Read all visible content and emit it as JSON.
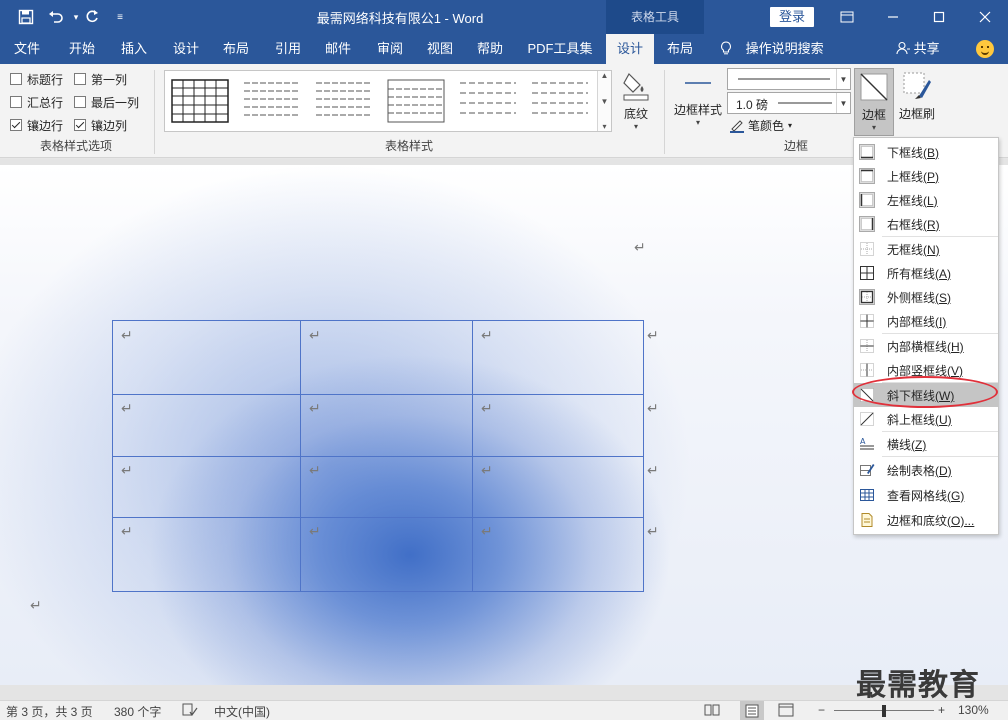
{
  "title_bar": {
    "doc_title": "最需网络科技有限公1 - Word",
    "tools_tab": "表格工具",
    "login": "登录"
  },
  "tabs": [
    {
      "label": "文件"
    },
    {
      "label": "开始"
    },
    {
      "label": "插入"
    },
    {
      "label": "设计"
    },
    {
      "label": "布局"
    },
    {
      "label": "引用"
    },
    {
      "label": "邮件"
    },
    {
      "label": "审阅"
    },
    {
      "label": "视图"
    },
    {
      "label": "帮助"
    },
    {
      "label": "PDF工具集"
    },
    {
      "label": "设计"
    },
    {
      "label": "布局"
    }
  ],
  "tell_me": "操作说明搜索",
  "share": "共享",
  "ribbon": {
    "style_options": {
      "items": [
        {
          "label": "标题行",
          "checked": false
        },
        {
          "label": "第一列",
          "checked": false
        },
        {
          "label": "汇总行",
          "checked": false
        },
        {
          "label": "最后一列",
          "checked": false
        },
        {
          "label": "镶边行",
          "checked": true
        },
        {
          "label": "镶边列",
          "checked": true
        }
      ],
      "group_label": "表格样式选项"
    },
    "table_styles": {
      "group_label": "表格样式"
    },
    "shading": "底纹",
    "borders_group": {
      "border_styles": "边框样式",
      "pen_weight": "1.0 磅",
      "pen_color": "笔颜色",
      "borders": "边框",
      "border_painter": "边框刷",
      "group_label": "边框"
    }
  },
  "border_menu": {
    "items": [
      {
        "label": "下框线",
        "key": "(B)"
      },
      {
        "label": "上框线",
        "key": "(P)"
      },
      {
        "label": "左框线",
        "key": "(L)"
      },
      {
        "label": "右框线",
        "key": "(R)"
      },
      {
        "label": "无框线",
        "key": "(N)"
      },
      {
        "label": "所有框线",
        "key": "(A)"
      },
      {
        "label": "外侧框线",
        "key": "(S)"
      },
      {
        "label": "内部框线",
        "key": "(I)"
      },
      {
        "label": "内部横框线",
        "key": "(H)"
      },
      {
        "label": "内部竖框线",
        "key": "(V)"
      },
      {
        "label": "斜下框线",
        "key": "(W)"
      },
      {
        "label": "斜上框线",
        "key": "(U)"
      },
      {
        "label": "横线",
        "key": "(Z)"
      },
      {
        "label": "绘制表格",
        "key": "(D)"
      },
      {
        "label": "查看网格线",
        "key": "(G)"
      },
      {
        "label": "边框和底纹",
        "key": "(O)..."
      }
    ]
  },
  "document": {
    "paragraph_mark": "↵"
  },
  "status_bar": {
    "page": "第 3 页，共 3 页",
    "words": "380 个字",
    "language": "中文(中国)",
    "zoom": "130%"
  },
  "watermark": "最需教育",
  "colors": {
    "accent": "#2b579a",
    "highlight_ring": "#e0303a",
    "table_border": "#4f74c8"
  }
}
